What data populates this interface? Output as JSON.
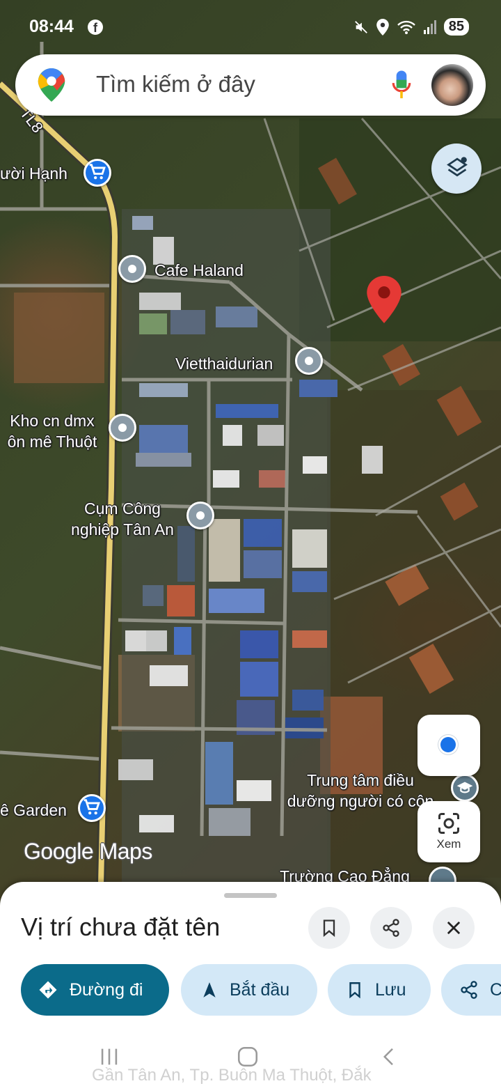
{
  "status_bar": {
    "time": "08:44",
    "facebook_icon": "f",
    "battery": "85"
  },
  "search": {
    "placeholder": "Tìm kiếm ở đây"
  },
  "map": {
    "road_label": "TL8",
    "labels": {
      "shop_top": "ười Hạnh",
      "cafe": "Cafe Haland",
      "vietthai": "Vietthaidurian",
      "kho_line1": "Kho cn dmx",
      "kho_line2": "ôn mê Thuột",
      "cum_line1": "Cụm Công",
      "cum_line2": "nghiệp Tân An",
      "trung_line1": "Trung tâm điều",
      "trung_line2": "dưỡng người có côn",
      "garden": "ê Garden",
      "truong": "Trường Cao Đẳng"
    },
    "logo": "Google Maps",
    "lens_label": "Xem"
  },
  "sheet": {
    "title": "Vị trí chưa đặt tên",
    "chips": {
      "directions": "Đường đi",
      "start": "Bắt đầu",
      "save": "Lưu",
      "share": "C"
    },
    "address": "Gần Tân An, Tp. Buôn Ma Thuột, Đắk"
  },
  "colors": {
    "primary_chip": "#0b6b8a",
    "secondary_chip": "#d3e8f7",
    "pin_red": "#e53935",
    "road_yellow": "#e8cf73",
    "accent_blue": "#1a73e8"
  }
}
